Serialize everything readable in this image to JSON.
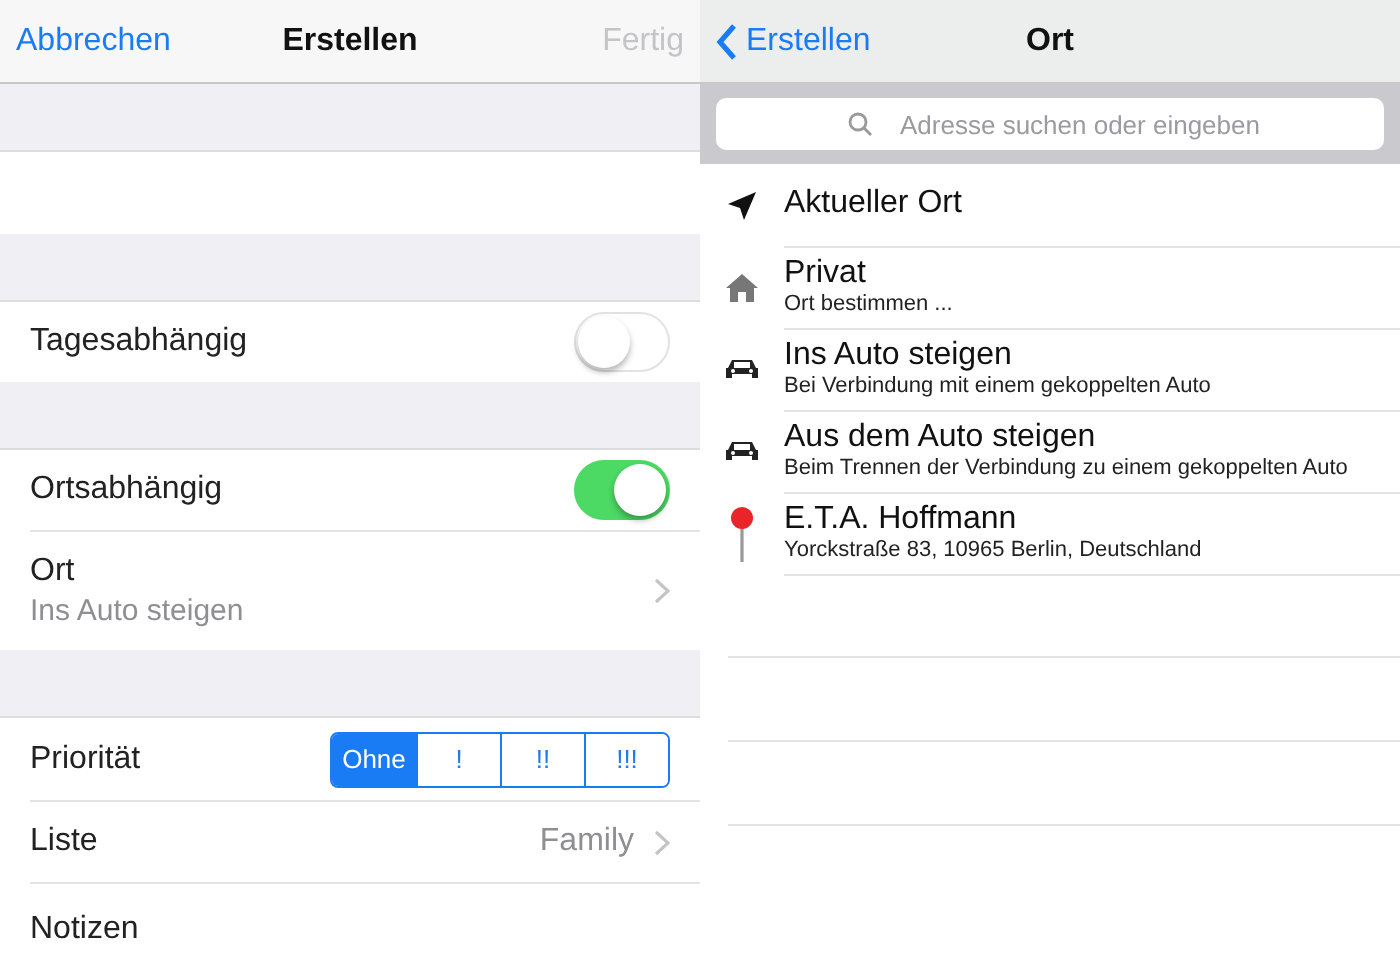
{
  "left": {
    "nav": {
      "cancel": "Abbrechen",
      "title": "Erstellen",
      "done": {
        "label": "Fertig",
        "disabled": true
      }
    },
    "groups": [
      [
        {
          "kind": "blank"
        }
      ],
      [
        {
          "kind": "toggle",
          "label": "Tagesabhängig",
          "on": false
        }
      ],
      [
        {
          "kind": "toggle",
          "label": "Ortsabhängig",
          "on": true
        },
        {
          "kind": "detail",
          "label": "Ort",
          "subtitle": "Ins Auto steigen"
        }
      ],
      [
        {
          "kind": "segmented",
          "label": "Priorität",
          "options": [
            {
              "label": "Ohne",
              "selected": true
            },
            {
              "label": "!",
              "selected": false
            },
            {
              "label": "!!",
              "selected": false
            },
            {
              "label": "!!!",
              "selected": false
            }
          ]
        },
        {
          "kind": "value",
          "label": "Liste",
          "value": "Family"
        },
        {
          "kind": "text",
          "label": "Notizen"
        }
      ]
    ]
  },
  "right": {
    "nav": {
      "back": "Erstellen",
      "title": "Ort"
    },
    "search": {
      "placeholder": "Adresse suchen oder eingeben"
    },
    "locations": [
      {
        "kind": "current",
        "title": "Aktueller Ort"
      },
      {
        "kind": "home",
        "title": "Privat",
        "subtitle": "Ort bestimmen ..."
      },
      {
        "kind": "car",
        "title": "Ins Auto steigen",
        "subtitle": "Bei Verbindung mit einem gekoppelten Auto"
      },
      {
        "kind": "car",
        "title": "Aus dem Auto steigen",
        "subtitle": "Beim Trennen der Verbindung zu einem gekoppelten Auto"
      },
      {
        "kind": "pin",
        "title": "E.T.A. Hoffmann",
        "subtitle": "Yorckstraße 83, 10965 Berlin, Deutschland"
      }
    ]
  }
}
